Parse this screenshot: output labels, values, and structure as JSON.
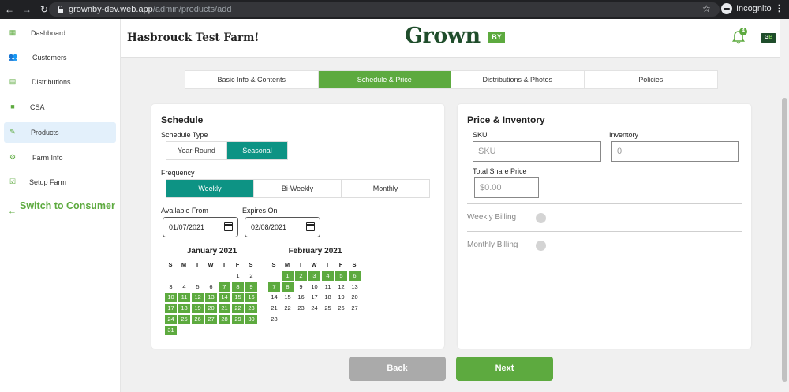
{
  "browser": {
    "url_host": "grownby-dev.web.app",
    "url_path": "/admin/products/add",
    "profile_label": "Incognito"
  },
  "sidebar": {
    "items": [
      {
        "label": "Dashboard",
        "icon": "dashboard-icon"
      },
      {
        "label": "Customers",
        "icon": "customers-icon"
      },
      {
        "label": "Distributions",
        "icon": "store-icon"
      },
      {
        "label": "CSA",
        "icon": "box-icon"
      },
      {
        "label": "Products",
        "icon": "carrot-icon",
        "active": true
      },
      {
        "label": "Farm Info",
        "icon": "tractor-icon"
      },
      {
        "label": "Setup Farm",
        "icon": "checklist-icon"
      }
    ],
    "switch_label": "Switch to Consumer"
  },
  "header": {
    "farm_name": "Hasbrouck Test Farm!",
    "logo_text": "Grown",
    "logo_badge": "BY",
    "notification_count": "4"
  },
  "tabs": [
    "Basic Info & Contents",
    "Schedule & Price",
    "Distributions & Photos",
    "Policies"
  ],
  "schedule": {
    "title": "Schedule",
    "type_label": "Schedule Type",
    "type_options": [
      "Year-Round",
      "Seasonal"
    ],
    "type_selected": "Seasonal",
    "frequency_label": "Frequency",
    "frequency_options": [
      "Weekly",
      "Bi-Weekly",
      "Monthly"
    ],
    "frequency_selected": "Weekly",
    "available_from_label": "Available From",
    "available_from_value": "01/07/2021",
    "expires_on_label": "Expires On",
    "expires_on_value": "02/08/2021",
    "day_headers": [
      "S",
      "M",
      "T",
      "W",
      "T",
      "F",
      "S"
    ],
    "calendars": [
      {
        "title": "January 2021",
        "first_weekday": 5,
        "days": 31,
        "highlight_from": 7,
        "highlight_to": 31
      },
      {
        "title": "February 2021",
        "first_weekday": 1,
        "days": 28,
        "highlight_from": 1,
        "highlight_to": 8
      }
    ]
  },
  "price": {
    "title": "Price & Inventory",
    "sku_label": "SKU",
    "sku_placeholder": "SKU",
    "inventory_label": "Inventory",
    "inventory_placeholder": "0",
    "share_price_label": "Total Share Price",
    "share_price_placeholder": "$0.00",
    "weekly_billing_label": "Weekly Billing",
    "monthly_billing_label": "Monthly Billing",
    "weekly_billing_on": false,
    "monthly_billing_on": false
  },
  "buttons": {
    "back": "Back",
    "next": "Next"
  },
  "colors": {
    "brand_green": "#5daa3f",
    "teal_selected": "#0d9384",
    "logo_dark_green": "#1f4d2b"
  }
}
